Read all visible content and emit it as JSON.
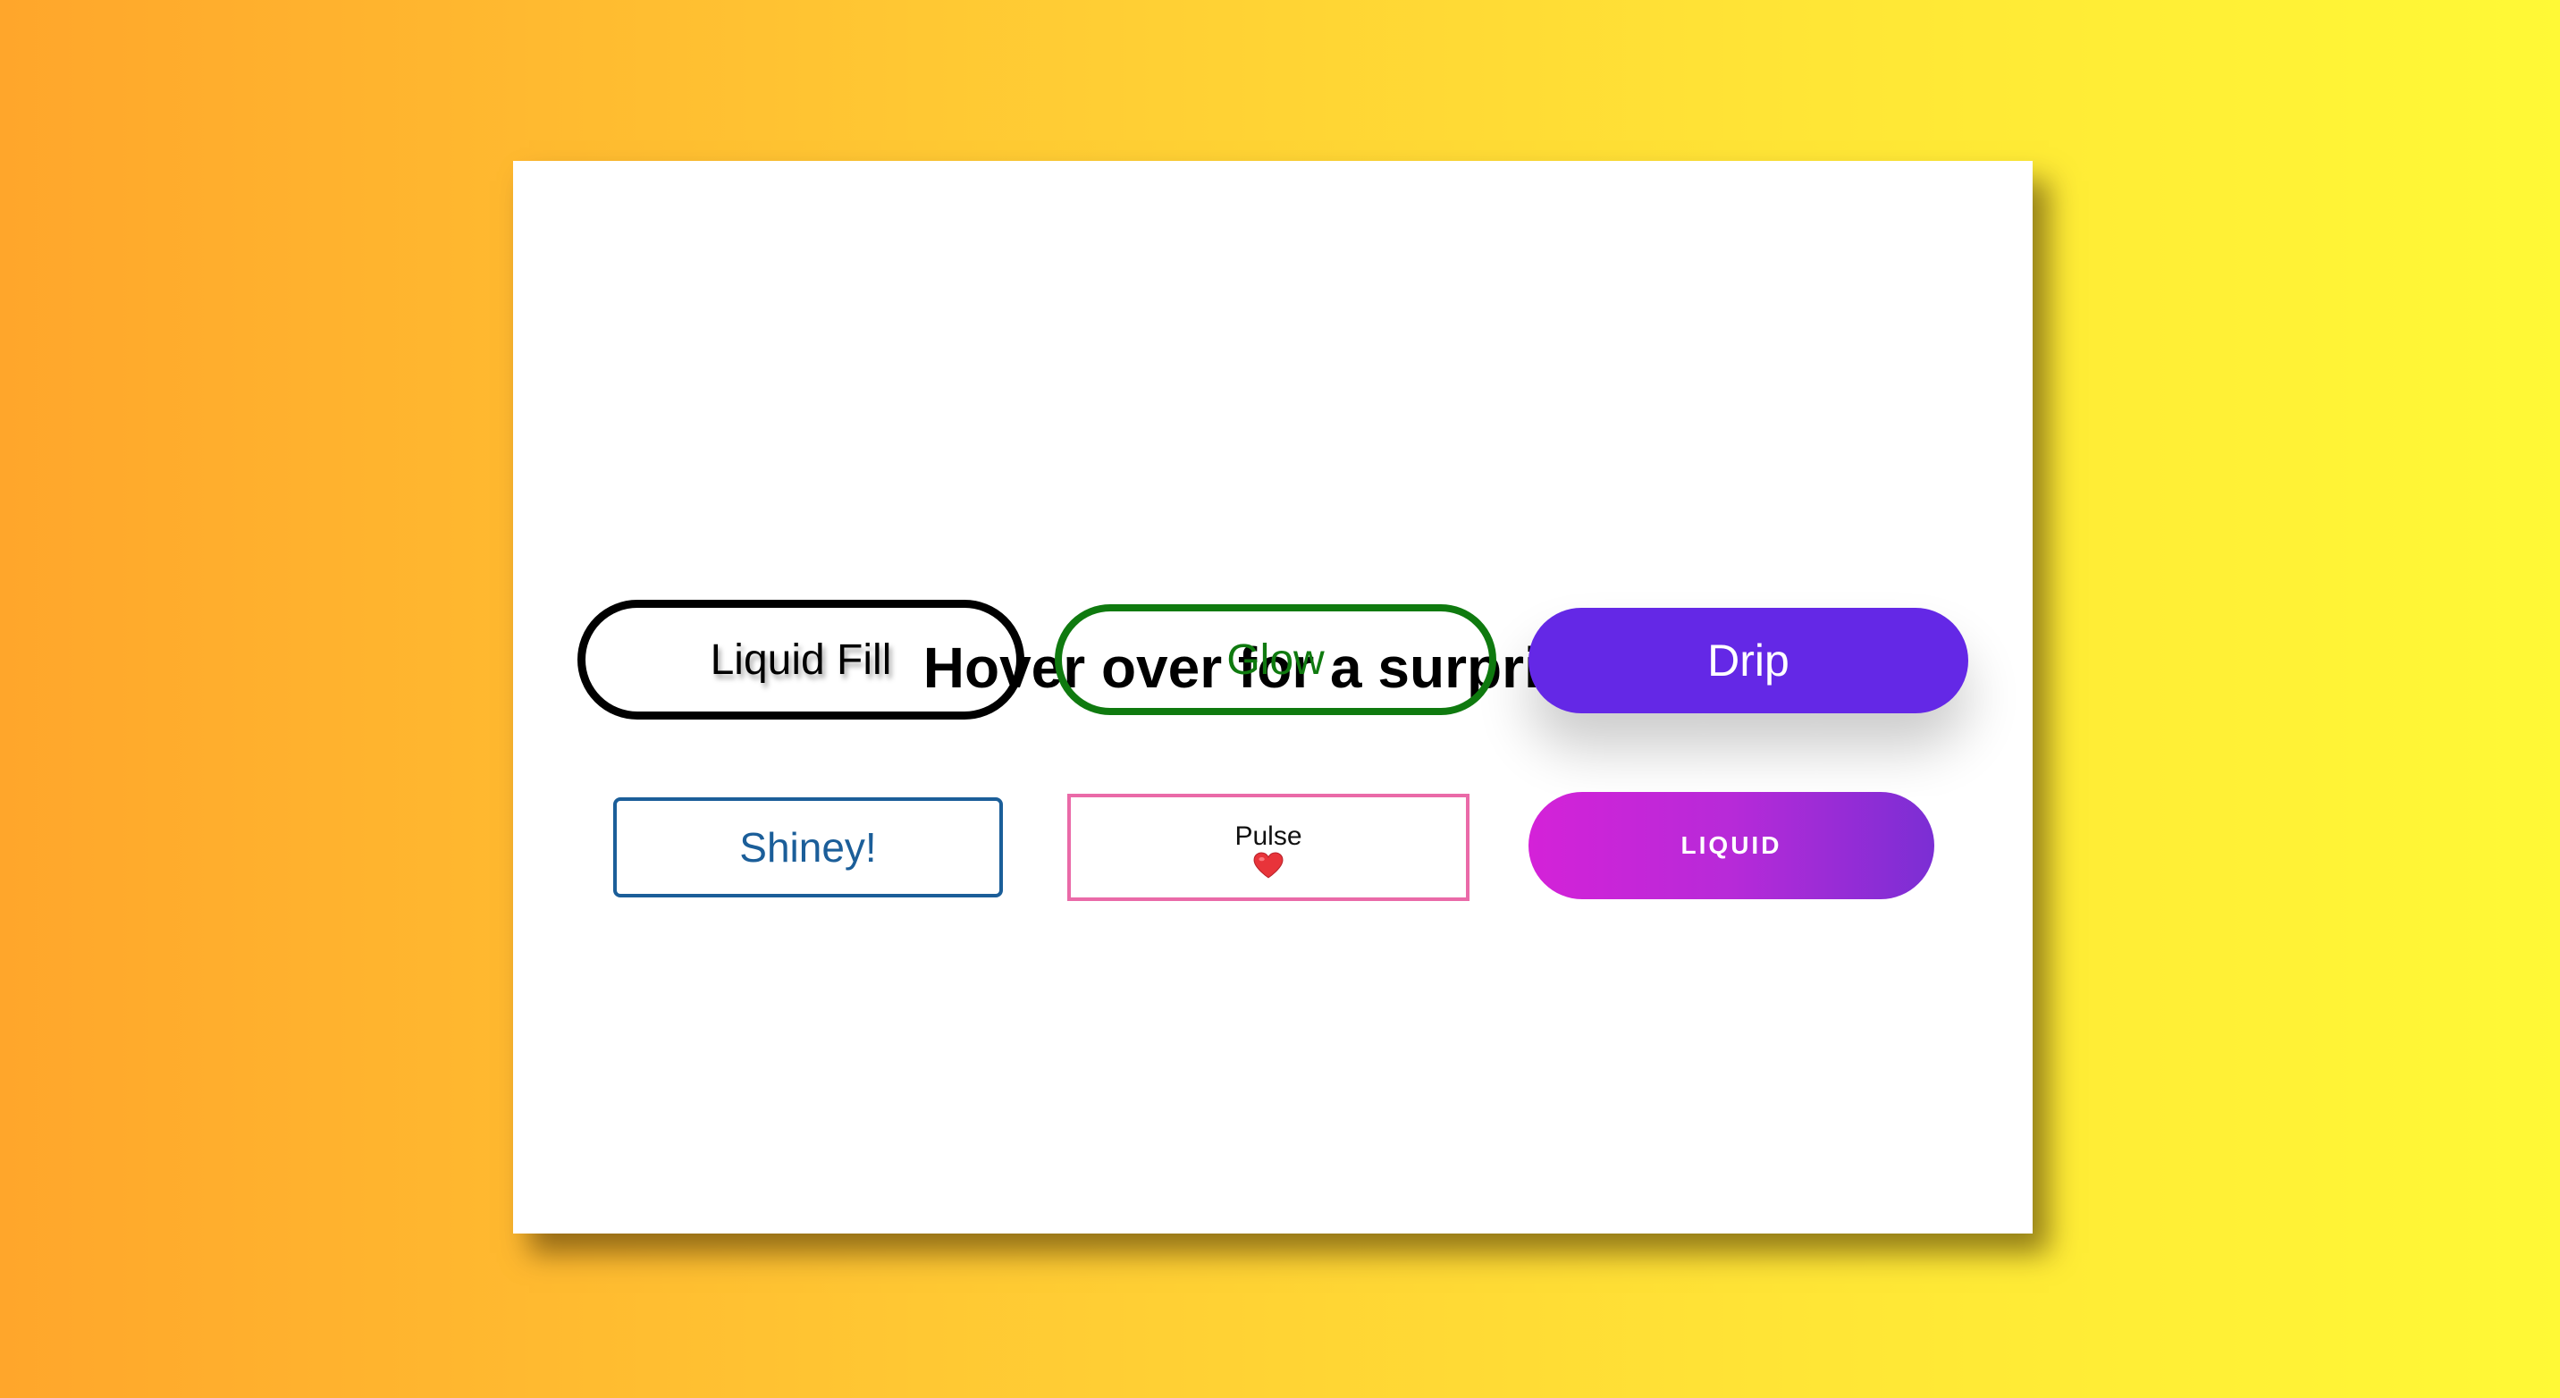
{
  "page": {
    "title": "Hover over for a surprise!"
  },
  "buttons": {
    "liquid_fill": "Liquid Fill",
    "glow": "Glow",
    "drip": "Drip",
    "shiney": "Shiney!",
    "pulse": "Pulse",
    "liquid": "LIQUID"
  },
  "icons": {
    "pulse_icon": "heart-icon"
  },
  "colors": {
    "background_gradient_start": "#ffa62b",
    "background_gradient_end": "#fff936",
    "glow": "#0f7a0f",
    "drip": "#6428e6",
    "shiney": "#1b5e99",
    "pulse_border": "#ea6aa8",
    "liquid_gradient_start": "#d422d8",
    "liquid_gradient_end": "#7b2ed4",
    "heart": "#e8343a"
  }
}
